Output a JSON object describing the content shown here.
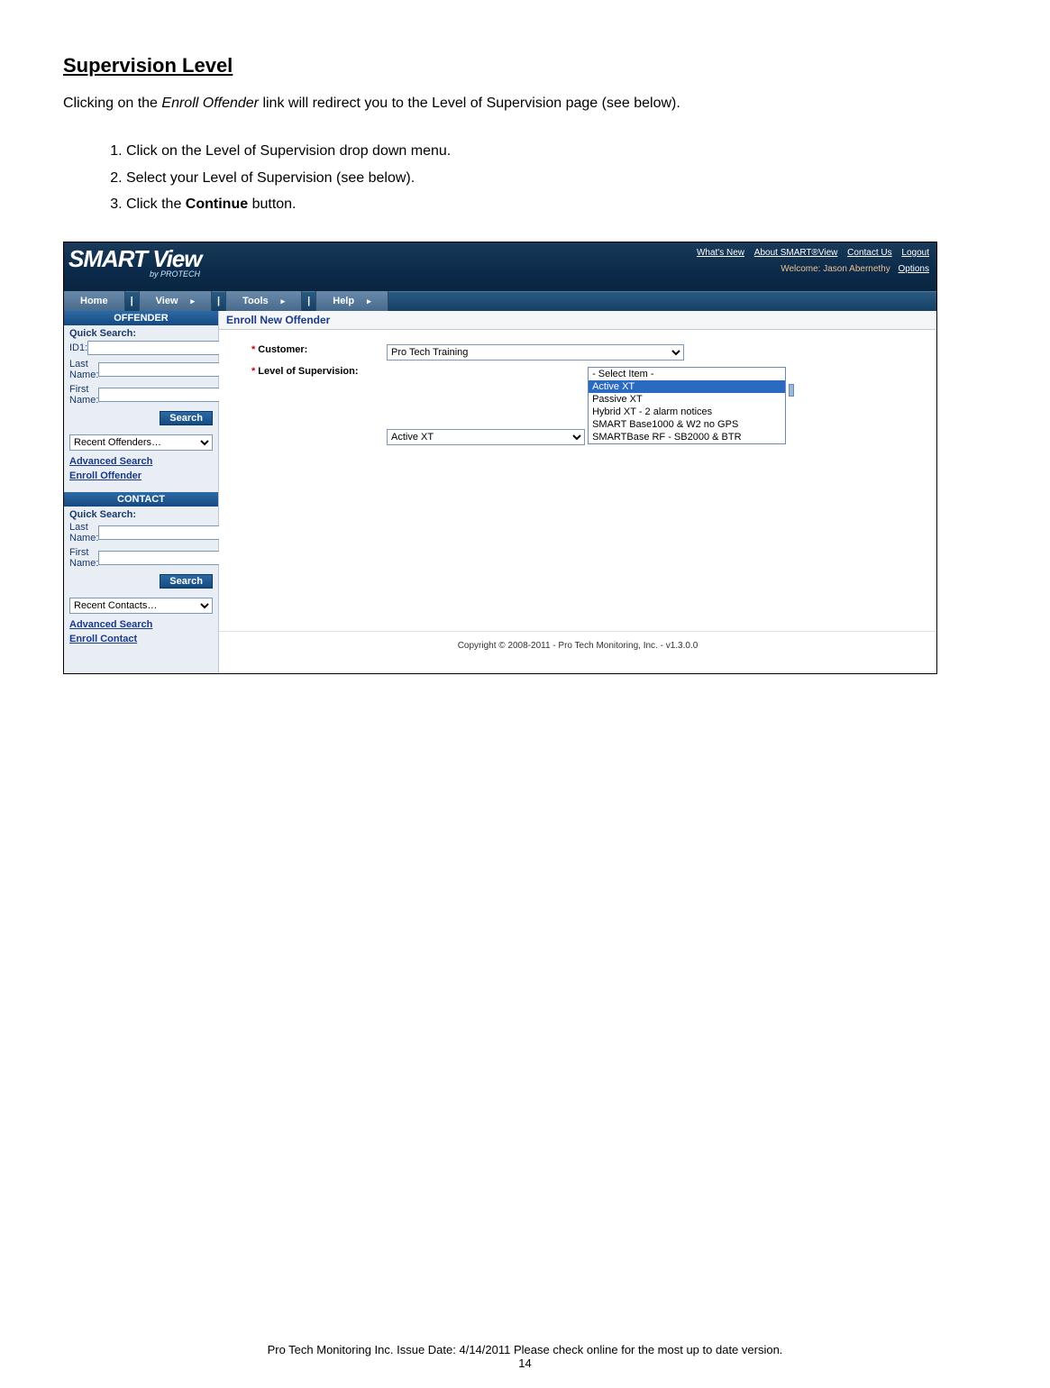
{
  "doc": {
    "title": "Supervision Level",
    "intro_pre": "Clicking on the ",
    "intro_em": "Enroll Offender",
    "intro_post": " link will redirect you to the Level of Supervision page (see below).",
    "steps": [
      "Click on the Level of Supervision drop down menu.",
      "Select your Level of Supervision (see below).",
      "Click the Continue button."
    ],
    "step3_pre": "Click the ",
    "step3_bold": "Continue",
    "step3_post": " button."
  },
  "appHeader": {
    "logoMain": "SMART View",
    "logoReg": "®",
    "logoSub": "by PROTECH",
    "topLinks": [
      "What's New",
      "About SMART®View",
      "Contact Us",
      "Logout"
    ],
    "welcomePrefix": "Welcome: ",
    "welcomeUser": "Jason Abernethy",
    "optionsLink": "Options"
  },
  "menu": [
    "Home",
    "View",
    "Tools",
    "Help"
  ],
  "sidebar": {
    "offenderHeader": "OFFENDER",
    "quickSearchLabel": "Quick Search:",
    "id1Label": "ID1:",
    "lastNameLabel": "Last Name:",
    "firstNameLabel": "First Name:",
    "searchBtn": "Search",
    "recentOffenders": "Recent Offenders…",
    "advancedSearch": "Advanced Search",
    "enrollOffender": "Enroll Offender",
    "contactHeader": "CONTACT",
    "recentContacts": "Recent Contacts…",
    "enrollContact": "Enroll Contact"
  },
  "content": {
    "header": "Enroll New Offender",
    "customerLabel": "Customer:",
    "customerValue": "Pro Tech Training",
    "losLabel": "Level of Supervision:",
    "losValue": "Active XT",
    "losOptions": [
      "- Select Item -",
      "Active XT",
      "Passive XT",
      "Hybrid XT - 2 alarm notices",
      "SMART Base1000 & W2 no GPS",
      "SMARTBase RF - SB2000 & BTR"
    ],
    "copyright": "Copyright © 2008-2011 - Pro Tech Monitoring, Inc. - v1.3.0.0"
  },
  "footer": {
    "line1": "Pro Tech Monitoring Inc. Issue Date: 4/14/2011 Please check online for the most up to date version.",
    "pageNum": "14"
  }
}
